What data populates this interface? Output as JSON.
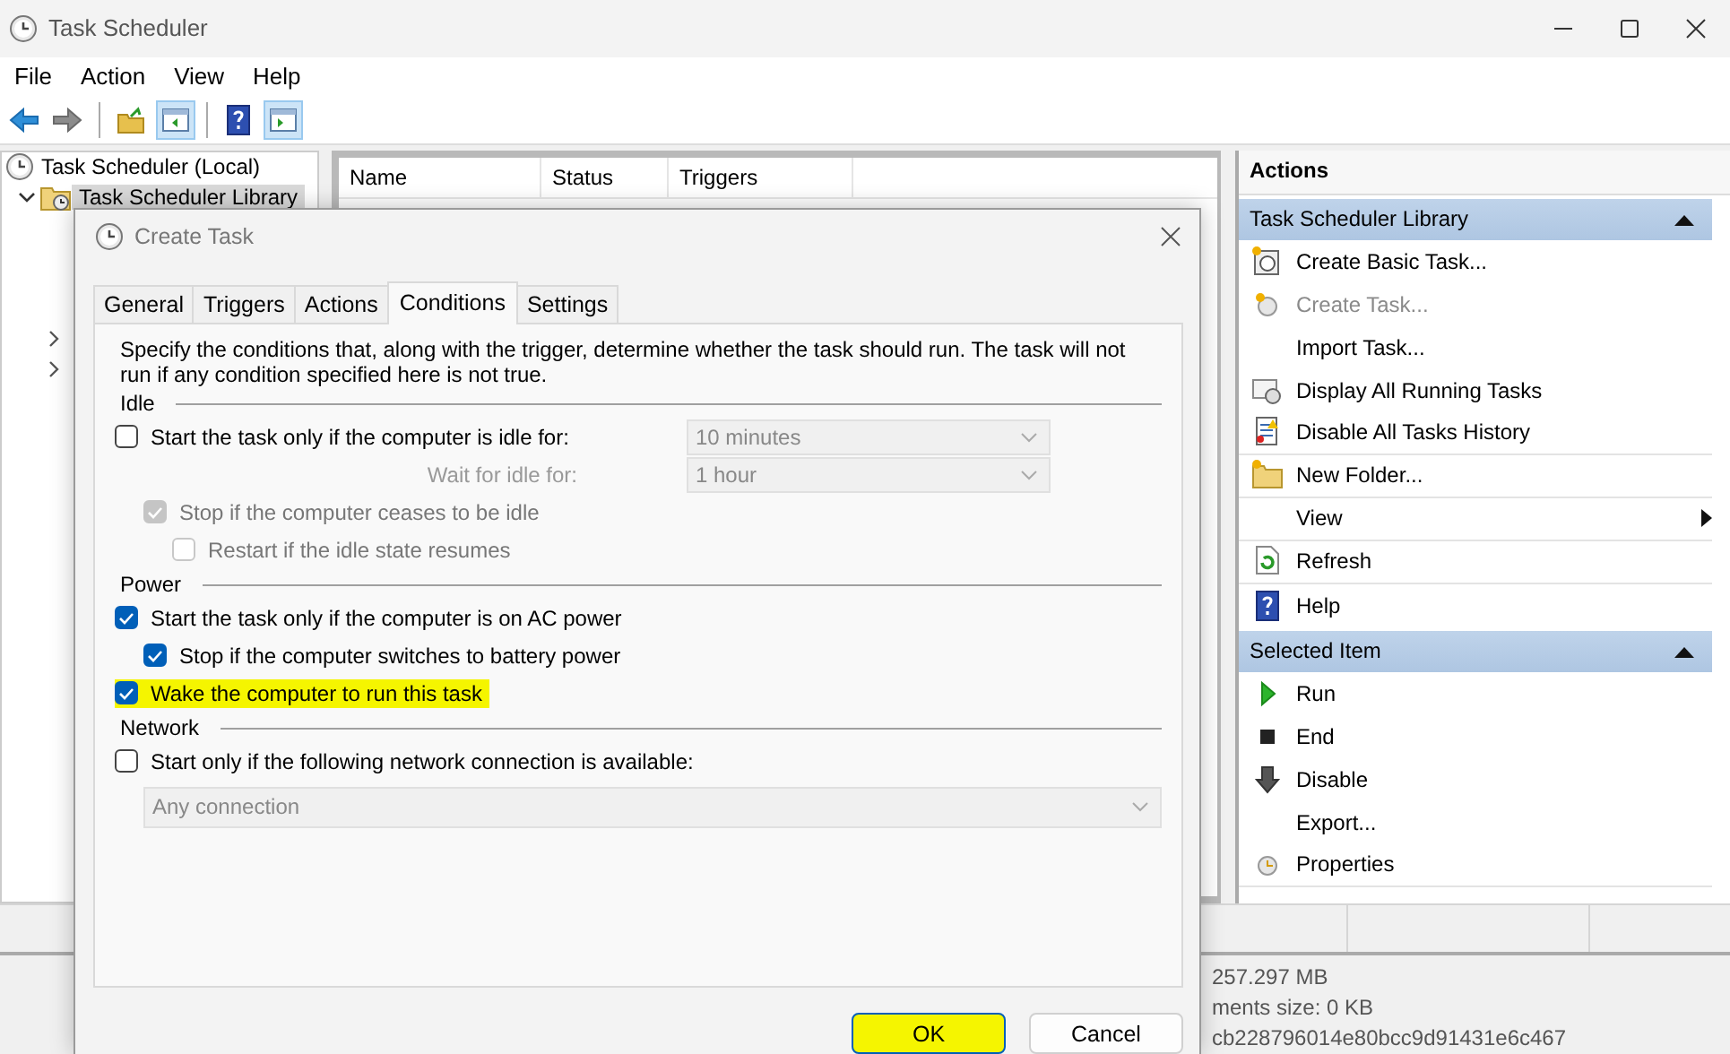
{
  "window": {
    "title": "Task Scheduler"
  },
  "menu": [
    "File",
    "Action",
    "View",
    "Help"
  ],
  "toolbar": [
    {
      "kind": "back",
      "on": false
    },
    {
      "kind": "forward",
      "on": false
    },
    {
      "kind": "separator"
    },
    {
      "kind": "up",
      "on": false
    },
    {
      "kind": "tree-pane",
      "on": true
    },
    {
      "kind": "separator"
    },
    {
      "kind": "help",
      "on": false
    },
    {
      "kind": "action-pane",
      "on": true
    }
  ],
  "tree": [
    {
      "label": "Task Scheduler (Local)",
      "selected": false,
      "children": [
        {
          "label": "Task Scheduler Library",
          "selected": true,
          "expanded": true,
          "children": [
            {
              "expanded": false
            },
            {
              "expanded": false
            }
          ]
        }
      ]
    }
  ],
  "table": {
    "columns": [
      "Name",
      "Status",
      "Triggers"
    ]
  },
  "actions": {
    "title": "Actions",
    "groups": [
      {
        "title": "Task Scheduler Library",
        "expanded": true,
        "items": [
          {
            "label": "Create Basic Task...",
            "disabled": false,
            "submenu": false,
            "separator_after": false
          },
          {
            "label": "Create Task...",
            "disabled": true,
            "submenu": false,
            "separator_after": false
          },
          {
            "label": "Import Task...",
            "disabled": false,
            "submenu": false,
            "separator_after": false
          },
          {
            "label": "Display All Running Tasks",
            "disabled": false,
            "submenu": false,
            "separator_after": false
          },
          {
            "label": "Disable All Tasks History",
            "disabled": false,
            "submenu": false,
            "separator_after": true
          },
          {
            "label": "New Folder...",
            "disabled": false,
            "submenu": false,
            "separator_after": true
          },
          {
            "label": "View",
            "disabled": false,
            "submenu": true,
            "separator_after": true
          },
          {
            "label": "Refresh",
            "disabled": false,
            "submenu": false,
            "separator_after": true
          },
          {
            "label": "Help",
            "disabled": false,
            "submenu": false,
            "separator_after": false
          }
        ]
      },
      {
        "title": "Selected Item",
        "expanded": true,
        "items": [
          {
            "label": "Run",
            "disabled": false,
            "submenu": false,
            "separator_after": false
          },
          {
            "label": "End",
            "disabled": false,
            "submenu": false,
            "separator_after": false
          },
          {
            "label": "Disable",
            "disabled": false,
            "submenu": false,
            "separator_after": false
          },
          {
            "label": "Export...",
            "disabled": false,
            "submenu": false,
            "separator_after": false
          },
          {
            "label": "Properties",
            "disabled": false,
            "submenu": false,
            "separator_after": true
          }
        ]
      }
    ]
  },
  "background_window": {
    "lines": [
      "257.297 MB",
      "ments size: 0 KB",
      "cb228796014e80bcc9d91431e6c467"
    ]
  },
  "dialog": {
    "title": "Create Task",
    "tabs": [
      {
        "label": "General",
        "selected": false
      },
      {
        "label": "Triggers",
        "selected": false
      },
      {
        "label": "Actions",
        "selected": false
      },
      {
        "label": "Conditions",
        "selected": true
      },
      {
        "label": "Settings",
        "selected": false
      }
    ],
    "description": "Specify the conditions that, along with the trigger, determine whether the task should run.  The task will not run  if any condition specified here is not true.",
    "sections": [
      {
        "title": "Idle",
        "items": [
          {
            "kind": "checkbox",
            "label": "Start the task only if the computer is idle for:",
            "checked": false,
            "disabled": false,
            "highlighted": false,
            "dropdown": {
              "value": "10 minutes",
              "disabled": true
            },
            "children": [
              {
                "kind": "field",
                "label": "Wait for idle for:",
                "disabled": true,
                "dropdown": {
                  "value": "1 hour",
                  "disabled": true
                }
              },
              {
                "kind": "checkbox",
                "label": "Stop if the computer ceases to be idle",
                "checked": true,
                "disabled": true,
                "highlighted": false,
                "children": [
                  {
                    "kind": "checkbox",
                    "label": "Restart if the idle state resumes",
                    "checked": false,
                    "disabled": true,
                    "highlighted": false
                  }
                ]
              }
            ]
          }
        ]
      },
      {
        "title": "Power",
        "items": [
          {
            "kind": "checkbox",
            "label": "Start the task only if the computer is on AC power",
            "checked": true,
            "disabled": false,
            "highlighted": false,
            "children": [
              {
                "kind": "checkbox",
                "label": "Stop if the computer switches to battery power",
                "checked": true,
                "disabled": false,
                "highlighted": false
              }
            ]
          },
          {
            "kind": "checkbox",
            "label": "Wake the computer to run this task",
            "checked": true,
            "disabled": false,
            "highlighted": true
          }
        ]
      },
      {
        "title": "Network",
        "items": [
          {
            "kind": "checkbox",
            "label": "Start only if the following network connection is available:",
            "checked": false,
            "disabled": false,
            "highlighted": false,
            "children": [
              {
                "kind": "dropdown",
                "value": "Any connection",
                "disabled": true
              }
            ]
          }
        ]
      }
    ],
    "buttons": [
      {
        "label": "OK",
        "default": true,
        "highlighted": true
      },
      {
        "label": "Cancel",
        "default": false,
        "highlighted": false
      }
    ]
  }
}
